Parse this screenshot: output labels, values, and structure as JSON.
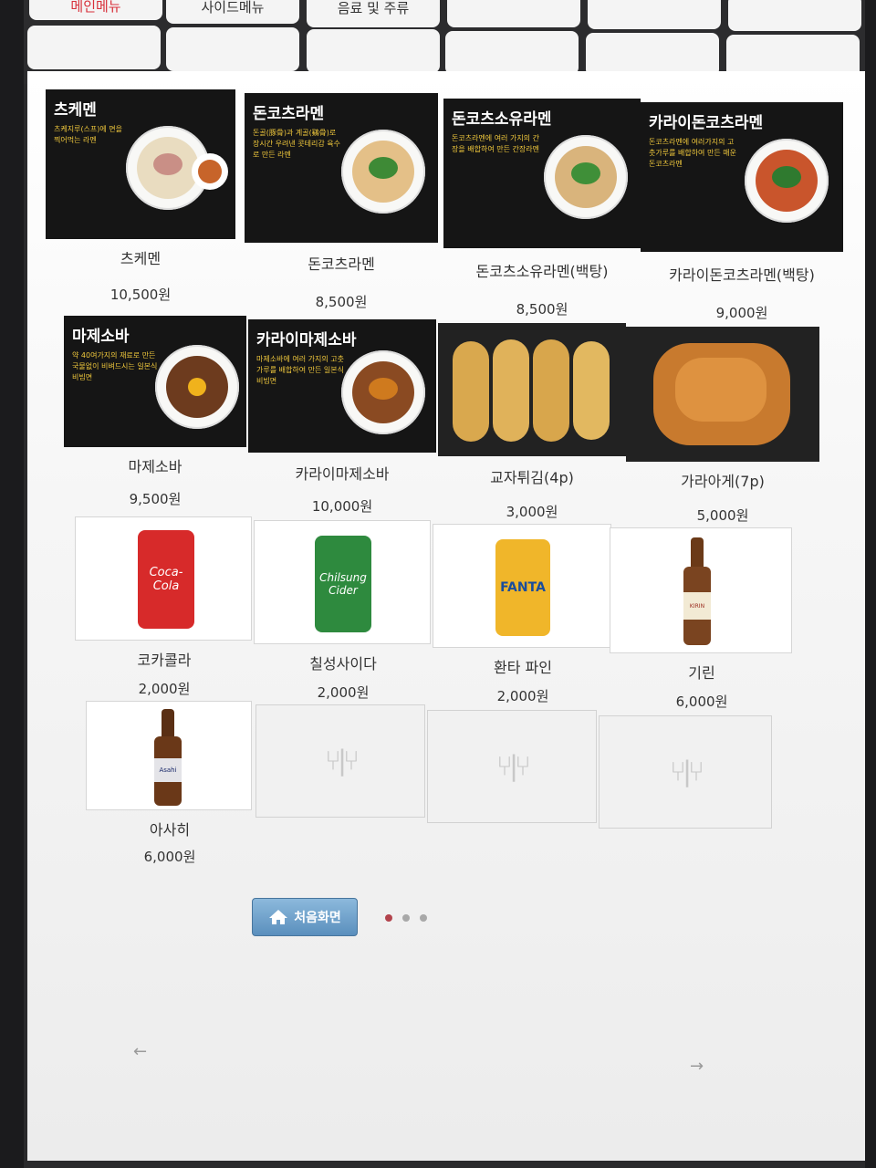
{
  "tabs": [
    {
      "label": "메인메뉴",
      "active": true
    },
    {
      "label": "사이드메뉴",
      "active": false
    },
    {
      "label": "음료 및 주류",
      "active": false
    },
    {
      "label": "",
      "active": false
    },
    {
      "label": "",
      "active": false
    },
    {
      "label": "",
      "active": false
    },
    {
      "label": "",
      "active": false
    },
    {
      "label": "",
      "active": false
    },
    {
      "label": "",
      "active": false
    },
    {
      "label": "",
      "active": false
    },
    {
      "label": "",
      "active": false
    },
    {
      "label": "",
      "active": false
    }
  ],
  "ramen": [
    {
      "title": "츠케멘",
      "desc": "츠케지루(스프)에 면을 찍어먹는 라멘",
      "name": "츠케멘",
      "price": "10,500원"
    },
    {
      "title": "돈코츠라멘",
      "desc": "돈골(豚骨)과 계골(鷄骨)로 장시간 우려낸 콧테리감 육수로 만든 라멘",
      "name": "돈코츠라멘",
      "price": "8,500원"
    },
    {
      "title": "돈코츠소유라멘",
      "desc": "돈코츠라멘에 여러 가지의 간장을 배합하여 만든 간장라멘",
      "name": "돈코츠소유라멘(백탕)",
      "price": "8,500원"
    },
    {
      "title": "카라이돈코츠라멘",
      "desc": "돈코츠라멘에 여러가지의 고춧가루를 배합하여 만든 매운돈코츠라멘",
      "name": "카라이돈코츠라멘(백탕)",
      "price": "9,000원"
    },
    {
      "title": "마제소바",
      "desc": "약 40여가지의 재료로 만든 국물없이 비벼드시는 일본식 비빔면",
      "name": "마제소바",
      "price": "9,500원"
    },
    {
      "title": "카라이마제소바",
      "desc": "마제소바에 여러 가지의 고춧가루를 배합하여 만든 일본식 비빔면",
      "name": "카라이마제소바",
      "price": "10,000원"
    }
  ],
  "sides": [
    {
      "name": "교자튀김(4p)",
      "price": "3,000원"
    },
    {
      "name": "가라아게(7p)",
      "price": "5,000원"
    }
  ],
  "drinks": [
    {
      "name": "코카콜라",
      "price": "2,000원",
      "label": "Coca-Cola"
    },
    {
      "name": "칠성사이다",
      "price": "2,000원",
      "label": "Chilsung Cider"
    },
    {
      "name": "환타 파인",
      "price": "2,000원",
      "label": "FANTA"
    },
    {
      "name": "기린",
      "price": "6,000원",
      "label": "KIRIN"
    },
    {
      "name": "아사히",
      "price": "6,000원",
      "label": "Asahi"
    }
  ],
  "home_button": "처음화면",
  "pagination": {
    "current": 1,
    "total": 3
  }
}
